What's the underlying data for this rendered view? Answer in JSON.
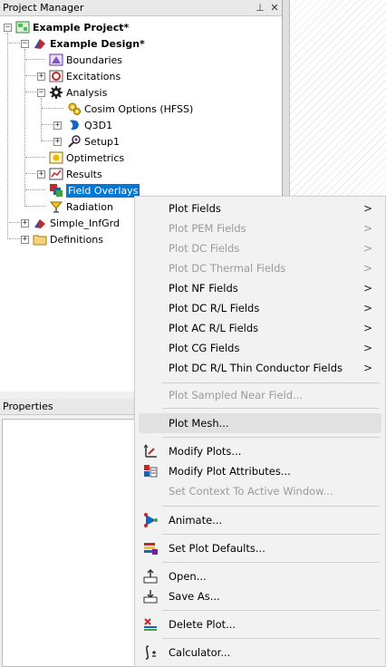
{
  "project_manager": {
    "title": "Project Manager",
    "pin_glyph": "⊥",
    "close_glyph": "✕",
    "tree": [
      {
        "label": "Example Project*",
        "bold": true
      },
      {
        "label": "Example Design*",
        "bold": true
      },
      {
        "label": "Boundaries"
      },
      {
        "label": "Excitations"
      },
      {
        "label": "Analysis"
      },
      {
        "label": "Cosim Options (HFSS)"
      },
      {
        "label": "Q3D1"
      },
      {
        "label": "Setup1"
      },
      {
        "label": "Optimetrics"
      },
      {
        "label": "Results"
      },
      {
        "label": "Field Overlays",
        "selected": true
      },
      {
        "label": "Radiation"
      },
      {
        "label": "Simple_InfGrd"
      },
      {
        "label": "Definitions"
      }
    ]
  },
  "properties": {
    "title": "Properties"
  },
  "context_menu": {
    "items": [
      {
        "label": "Plot Fields",
        "submenu": true,
        "enabled": true
      },
      {
        "label": "Plot PEM Fields",
        "submenu": true,
        "enabled": false
      },
      {
        "label": "Plot DC Fields",
        "submenu": true,
        "enabled": false
      },
      {
        "label": "Plot DC Thermal Fields",
        "submenu": true,
        "enabled": false
      },
      {
        "label": "Plot NF Fields",
        "submenu": true,
        "enabled": true
      },
      {
        "label": "Plot DC R/L Fields",
        "submenu": true,
        "enabled": true
      },
      {
        "label": "Plot AC R/L Fields",
        "submenu": true,
        "enabled": true
      },
      {
        "label": "Plot CG Fields",
        "submenu": true,
        "enabled": true
      },
      {
        "label": "Plot DC R/L Thin Conductor Fields",
        "submenu": true,
        "enabled": true
      },
      {
        "label": "Plot Sampled Near Field...",
        "enabled": false
      },
      {
        "label": "Plot Mesh...",
        "enabled": true,
        "hover": true
      },
      {
        "label": "Modify Plots...",
        "enabled": true
      },
      {
        "label": "Modify Plot Attributes...",
        "enabled": true
      },
      {
        "label": "Set Context To Active Window...",
        "enabled": false
      },
      {
        "label": "Animate...",
        "enabled": true
      },
      {
        "label": "Set Plot Defaults...",
        "enabled": true
      },
      {
        "label": "Open...",
        "enabled": true
      },
      {
        "label": "Save As...",
        "enabled": true
      },
      {
        "label": "Delete Plot...",
        "enabled": true
      },
      {
        "label": "Calculator...",
        "enabled": true
      }
    ],
    "submenu_arrow": ">"
  },
  "colors": {
    "selection": "#0078d7",
    "menu_bg": "#f2f2f2",
    "disabled_text": "#9a9a9a"
  }
}
